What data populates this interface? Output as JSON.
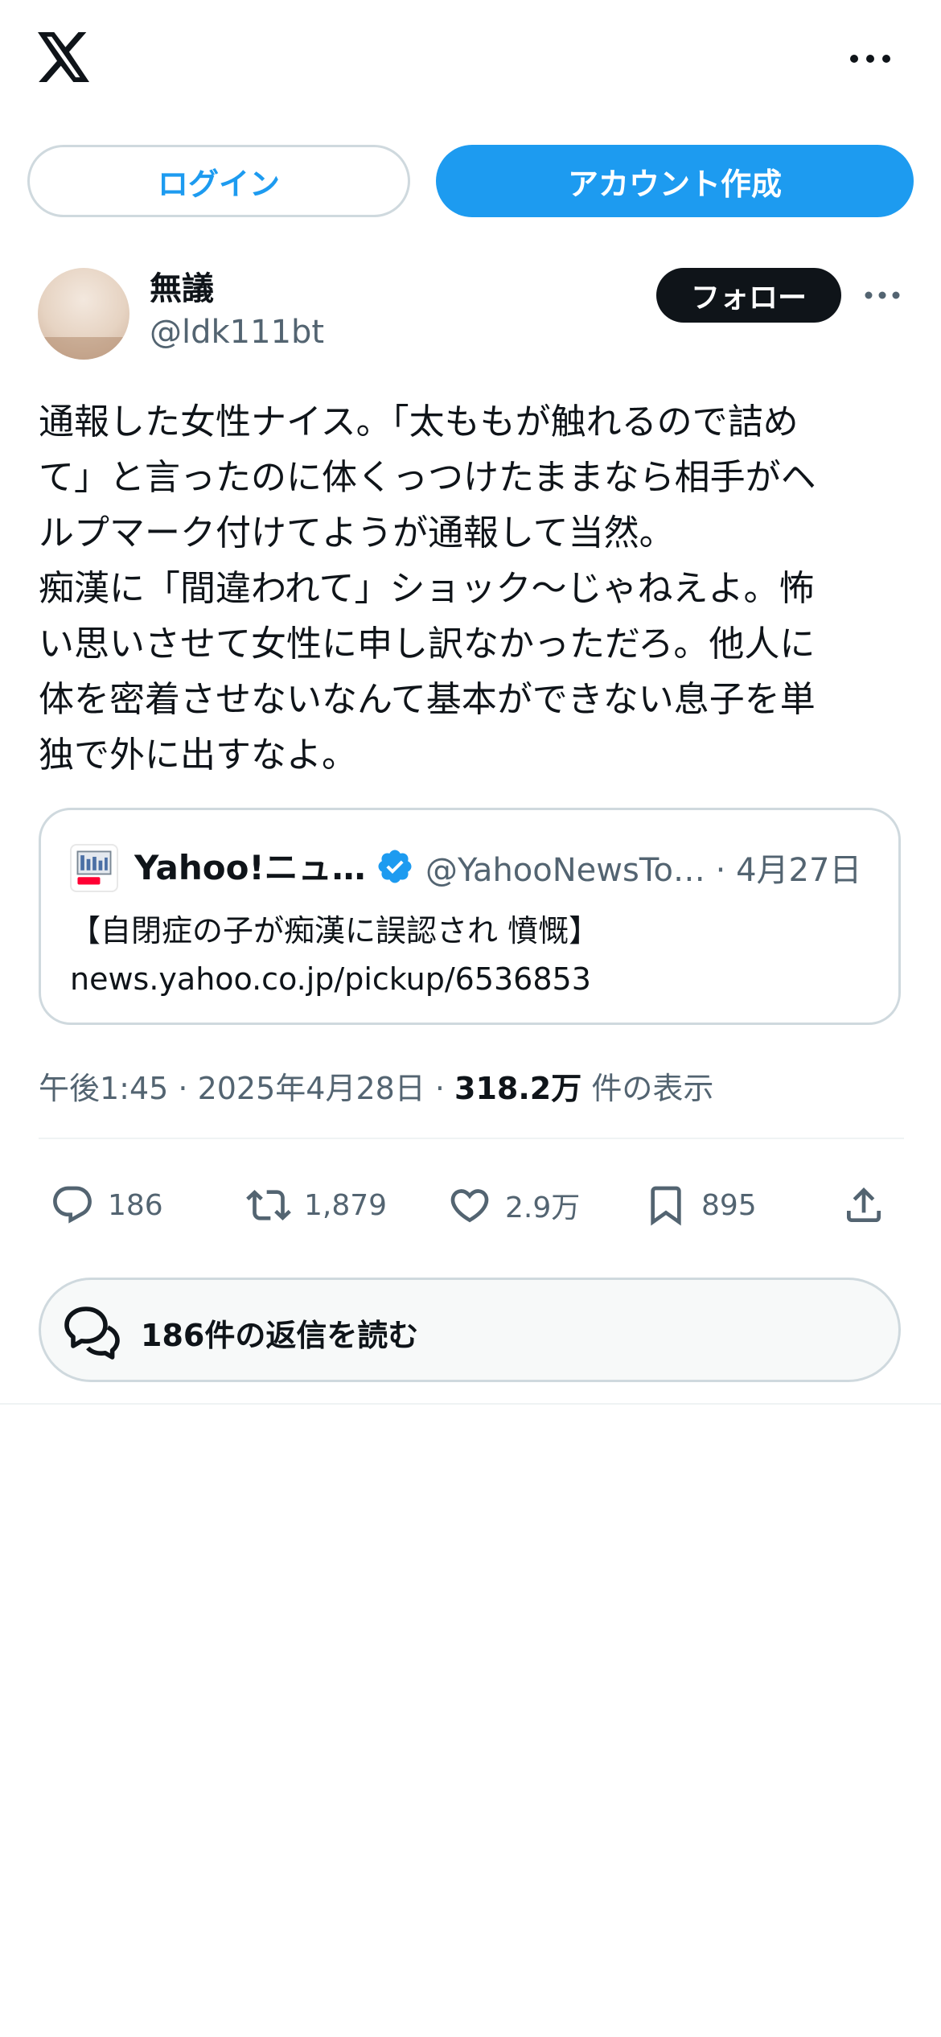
{
  "header": {
    "logo_icon": "x-logo-icon",
    "more_icon": "more-icon"
  },
  "auth": {
    "login_label": "ログイン",
    "signup_label": "アカウント作成"
  },
  "post": {
    "author": {
      "display_name": "無議",
      "handle": "@ldk111bt"
    },
    "follow_label": "フォロー",
    "text_lines": [
      "通報した女性ナイス。「太ももが触れるので詰め",
      "て」と言ったのに体くっつけたままなら相手がヘ",
      "ルプマーク付けてようが通報して当然。",
      "痴漢に「間違われて」ショック〜じゃねえよ。怖",
      "い思いさせて女性に申し訳なかっただろ。他人に",
      "体を密着させないなんて基本ができない息子を単",
      "独で外に出すなよ。"
    ],
    "quote": {
      "name": "Yahoo!ニュ…",
      "meta": "@YahooNewsTo… · 4月27日",
      "headline": "【自閉症の子が痴漢に誤認され 憤慨】",
      "link": "news.yahoo.co.jp/pickup/6536853"
    },
    "timestamp": "午後1:45 · 2025年4月28日 · ",
    "views_count": "318.2万",
    "views_label": " 件の表示",
    "stats": {
      "replies": "186",
      "reposts": "1,879",
      "likes": "2.9万",
      "bookmarks": "895"
    },
    "read_replies_label": "186件の返信を読む"
  },
  "colors": {
    "accent": "#1d9bf0",
    "text": "#0f1419",
    "muted": "#536471",
    "border": "#cfd9de"
  }
}
